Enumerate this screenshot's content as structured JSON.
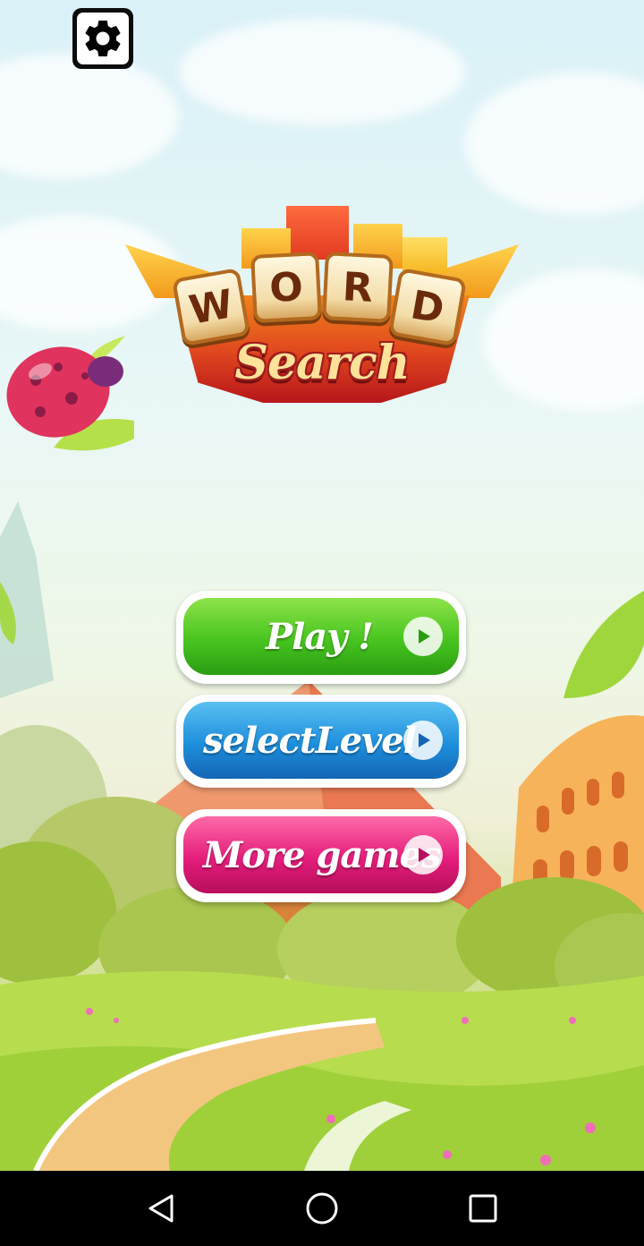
{
  "logo": {
    "title_letters": [
      "W",
      "O",
      "R",
      "D"
    ],
    "subtitle": "Search"
  },
  "menu": {
    "play_label": "Play !",
    "select_level_label": "selectLevel",
    "more_games_label": "More games"
  },
  "icons": {
    "settings": "gear-icon",
    "play_arrow": "play-arrow-icon",
    "nav_back": "back-triangle-icon",
    "nav_home": "home-circle-icon",
    "nav_recents": "recents-square-icon"
  },
  "colors": {
    "play_button": "#47c41f",
    "select_level_button": "#1d8fdc",
    "more_games_button": "#e41d7b",
    "nav_bar": "#000000"
  }
}
